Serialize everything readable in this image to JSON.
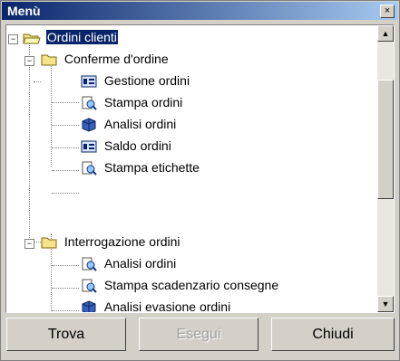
{
  "window": {
    "title": "Menù",
    "close_label": "×"
  },
  "tree": {
    "toggles": {
      "open": "−"
    },
    "root": {
      "label": "Ordini clienti"
    },
    "groups": [
      {
        "label": "Conferme d'ordine",
        "items": [
          {
            "label": "Gestione ordini",
            "icon": "form-icon"
          },
          {
            "label": "Stampa ordini",
            "icon": "print-preview-icon"
          },
          {
            "label": "Analisi ordini",
            "icon": "cube-icon"
          },
          {
            "label": "Saldo ordini",
            "icon": "form-icon"
          },
          {
            "label": "Stampa etichette",
            "icon": "print-preview-icon"
          }
        ]
      },
      {
        "label": "Interrogazione ordini",
        "items": [
          {
            "label": "Analisi ordini",
            "icon": "print-preview-icon"
          },
          {
            "label": "Stampa scadenzario consegne",
            "icon": "print-preview-icon"
          },
          {
            "label": "Analisi evasione ordini",
            "icon": "cube-icon"
          }
        ]
      }
    ]
  },
  "scrollbar": {
    "up": "▲",
    "down": "▼"
  },
  "buttons": {
    "find": "Trova",
    "execute": "Esegui",
    "close": "Chiudi"
  }
}
